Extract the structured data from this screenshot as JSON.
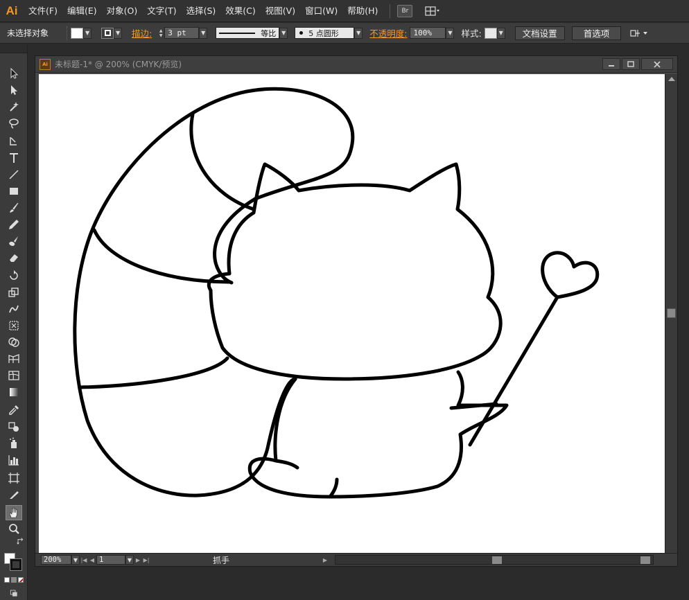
{
  "app": {
    "logo": "Ai"
  },
  "menu": {
    "items": [
      "文件(F)",
      "编辑(E)",
      "对象(O)",
      "文字(T)",
      "选择(S)",
      "效果(C)",
      "视图(V)",
      "窗口(W)",
      "帮助(H)"
    ],
    "bridge_label": "Br",
    "workspace_icon": "grid-icon"
  },
  "control": {
    "selection_status": "未选择对象",
    "stroke_label": "描边:",
    "stroke_weight": "3 pt",
    "profile_label": "等比",
    "brush_label": "5 点圆形",
    "opacity_label": "不透明度:",
    "opacity_value": "100%",
    "style_label": "样式:",
    "doc_setup_button": "文档设置",
    "preferences_button": "首选项"
  },
  "document": {
    "title": "未标题-1* @ 200% (CMYK/预览)",
    "icon_label": "Ai"
  },
  "status": {
    "zoom": "200%",
    "artboard": "1",
    "tool": "抓手"
  },
  "tools": [
    "selection-tool-icon",
    "direct-selection-tool-icon",
    "magic-wand-tool-icon",
    "lasso-tool-icon",
    "pen-tool-icon",
    "type-tool-icon",
    "line-tool-icon",
    "rectangle-tool-icon",
    "paintbrush-tool-icon",
    "pencil-tool-icon",
    "blob-brush-tool-icon",
    "eraser-tool-icon",
    "rotate-tool-icon",
    "scale-tool-icon",
    "warp-tool-icon",
    "free-transform-tool-icon",
    "shape-builder-tool-icon",
    "perspective-grid-tool-icon",
    "mesh-tool-icon",
    "gradient-tool-icon",
    "eyedropper-tool-icon",
    "blend-tool-icon",
    "symbol-sprayer-tool-icon",
    "column-graph-tool-icon",
    "artboard-tool-icon",
    "slice-tool-icon",
    "hand-tool-icon",
    "zoom-tool-icon"
  ],
  "colors": {
    "accent_orange": "#f39a1e",
    "canvas": "#ffffff",
    "chrome_dark": "#323232"
  }
}
